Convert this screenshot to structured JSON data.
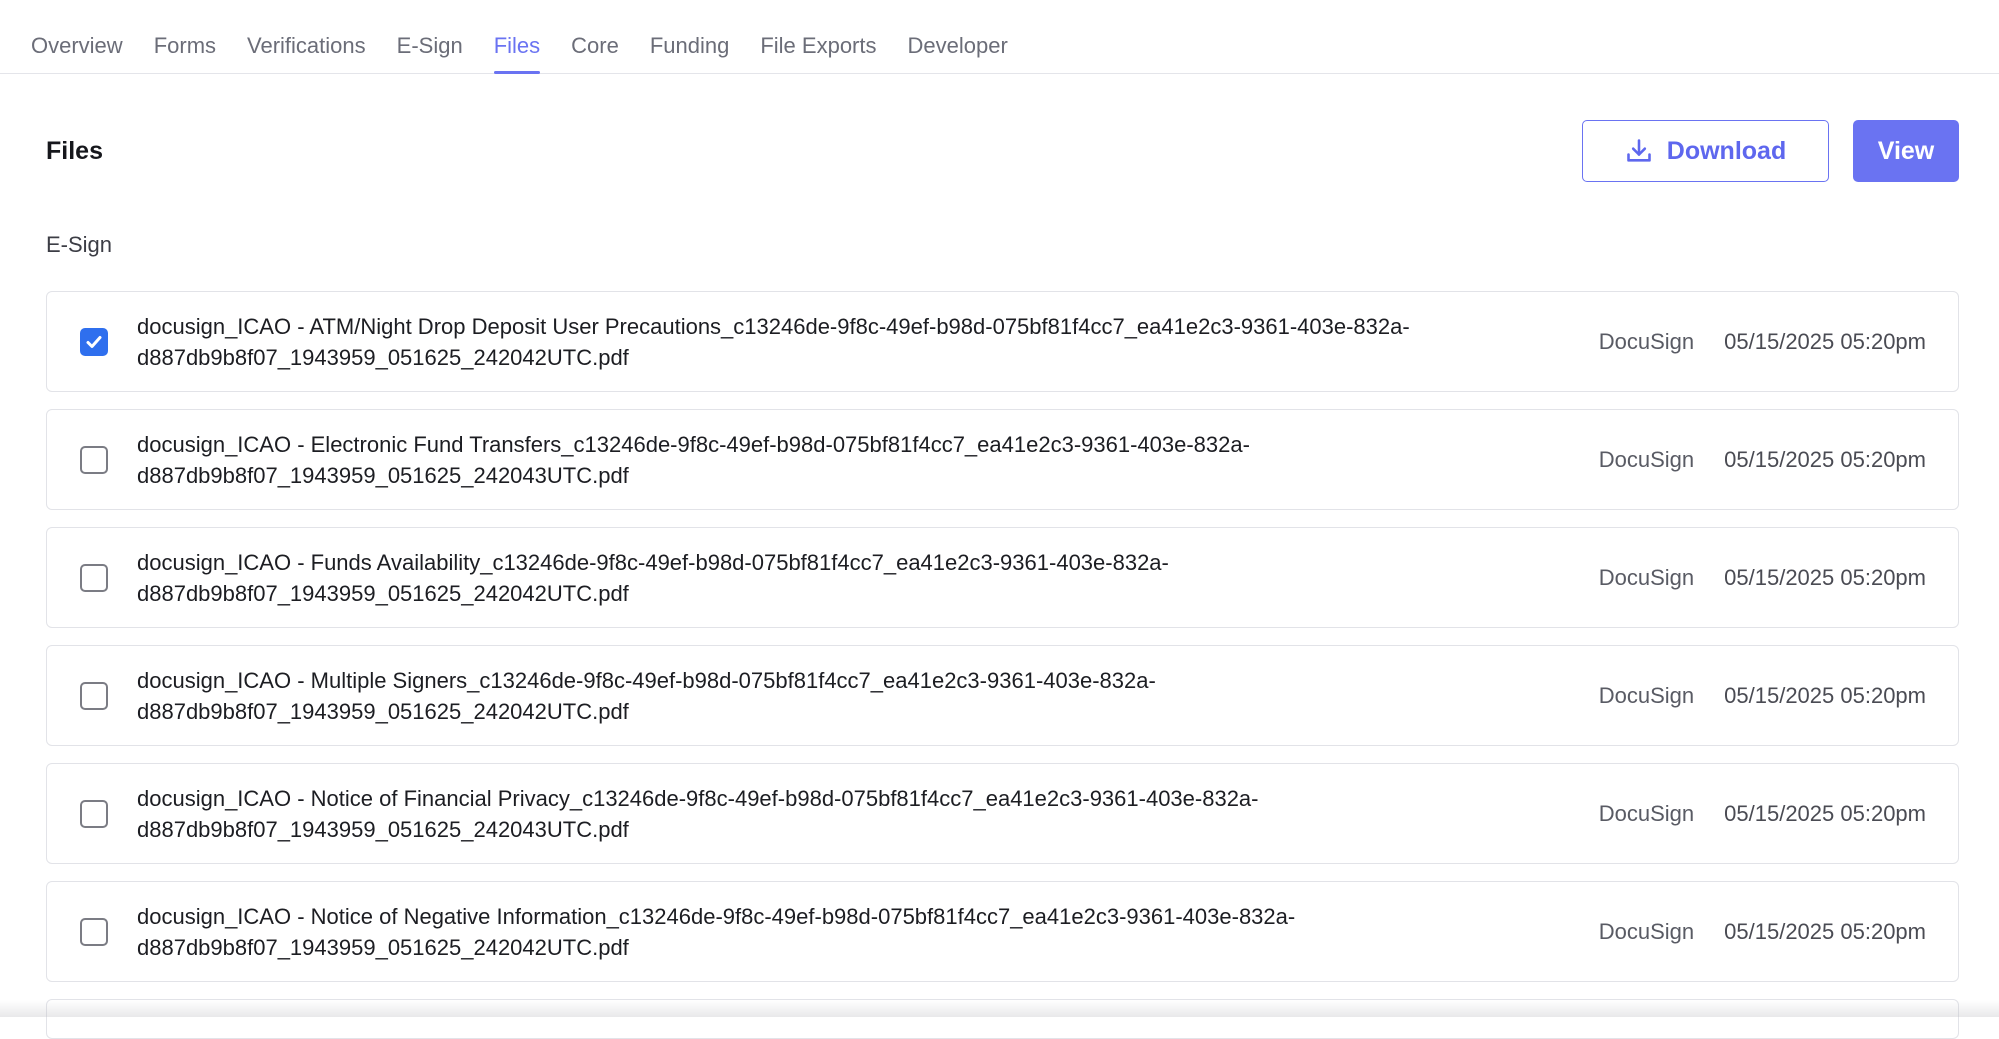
{
  "tabs": [
    {
      "label": "Overview",
      "active": false
    },
    {
      "label": "Forms",
      "active": false
    },
    {
      "label": "Verifications",
      "active": false
    },
    {
      "label": "E-Sign",
      "active": false
    },
    {
      "label": "Files",
      "active": true
    },
    {
      "label": "Core",
      "active": false
    },
    {
      "label": "Funding",
      "active": false
    },
    {
      "label": "File Exports",
      "active": false
    },
    {
      "label": "Developer",
      "active": false
    }
  ],
  "header": {
    "title": "Files",
    "download_label": "Download",
    "view_label": "View"
  },
  "section": {
    "label": "E-Sign"
  },
  "files": [
    {
      "line1": "docusign_ICAO - ATM/Night Drop Deposit User Precautions_c13246de-9f8c-49ef-b98d-075bf81f4cc7_ea41e2c3-9361-403e-832a-",
      "line2": "d887db9b8f07_1943959_051625_242042UTC.pdf",
      "source": "DocuSign",
      "date": "05/15/2025 05:20pm",
      "checked": true
    },
    {
      "line1": "docusign_ICAO - Electronic Fund Transfers_c13246de-9f8c-49ef-b98d-075bf81f4cc7_ea41e2c3-9361-403e-832a-",
      "line2": "d887db9b8f07_1943959_051625_242043UTC.pdf",
      "source": "DocuSign",
      "date": "05/15/2025 05:20pm",
      "checked": false
    },
    {
      "line1": "docusign_ICAO - Funds Availability_c13246de-9f8c-49ef-b98d-075bf81f4cc7_ea41e2c3-9361-403e-832a-",
      "line2": "d887db9b8f07_1943959_051625_242042UTC.pdf",
      "source": "DocuSign",
      "date": "05/15/2025 05:20pm",
      "checked": false
    },
    {
      "line1": "docusign_ICAO - Multiple Signers_c13246de-9f8c-49ef-b98d-075bf81f4cc7_ea41e2c3-9361-403e-832a-",
      "line2": "d887db9b8f07_1943959_051625_242042UTC.pdf",
      "source": "DocuSign",
      "date": "05/15/2025 05:20pm",
      "checked": false
    },
    {
      "line1": "docusign_ICAO - Notice of Financial Privacy_c13246de-9f8c-49ef-b98d-075bf81f4cc7_ea41e2c3-9361-403e-832a-",
      "line2": "d887db9b8f07_1943959_051625_242043UTC.pdf",
      "source": "DocuSign",
      "date": "05/15/2025 05:20pm",
      "checked": false
    },
    {
      "line1": "docusign_ICAO - Notice of Negative Information_c13246de-9f8c-49ef-b98d-075bf81f4cc7_ea41e2c3-9361-403e-832a-",
      "line2": "d887db9b8f07_1943959_051625_242042UTC.pdf",
      "source": "DocuSign",
      "date": "05/15/2025 05:20pm",
      "checked": false
    }
  ],
  "colors": {
    "accent": "#6a73f2",
    "checkbox_checked": "#2f6fee"
  }
}
